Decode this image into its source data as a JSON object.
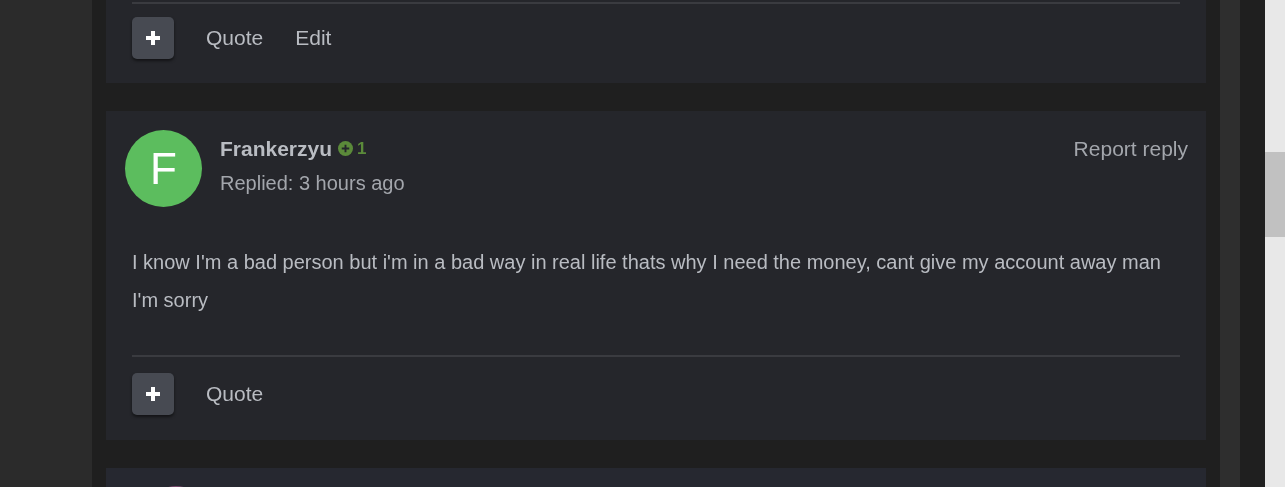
{
  "posts": [
    {
      "actions": [
        "Quote",
        "Edit"
      ]
    },
    {
      "author": {
        "initial": "F",
        "name": "Frankerzyu",
        "reputation": "1"
      },
      "meta": "Replied: 3 hours ago",
      "report": "Report reply",
      "body": "I know I'm a bad person but i'm in a bad way in real life thats why I need the money, cant give my account away man I'm sorry",
      "actions": [
        "Quote"
      ]
    }
  ]
}
